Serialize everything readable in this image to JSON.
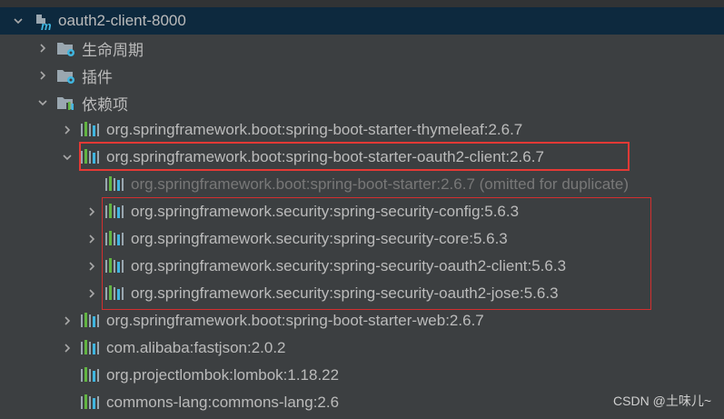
{
  "tree": {
    "root": {
      "label": "oauth2-client-8000",
      "icon": "maven-module-icon",
      "expanded": true,
      "selected": true
    },
    "lifecycle": {
      "label": "生命周期",
      "icon": "folder-gear-icon",
      "expanded": false
    },
    "plugins": {
      "label": "插件",
      "icon": "folder-gear-icon",
      "expanded": false
    },
    "dependencies": {
      "label": "依赖项",
      "icon": "folder-library-icon",
      "expanded": true
    },
    "deps": [
      {
        "label": "org.springframework.boot:spring-boot-starter-thymeleaf:2.6.7",
        "expandable": true,
        "expanded": false
      },
      {
        "label": "org.springframework.boot:spring-boot-starter-oauth2-client:2.6.7",
        "expandable": true,
        "expanded": true,
        "highlighted": true,
        "children": [
          {
            "label": "org.springframework.boot:spring-boot-starter:2.6.7 (omitted for duplicate)",
            "expandable": false,
            "omitted": true
          },
          {
            "label": "org.springframework.security:spring-security-config:5.6.3",
            "expandable": true
          },
          {
            "label": "org.springframework.security:spring-security-core:5.6.3",
            "expandable": true
          },
          {
            "label": "org.springframework.security:spring-security-oauth2-client:5.6.3",
            "expandable": true
          },
          {
            "label": "org.springframework.security:spring-security-oauth2-jose:5.6.3",
            "expandable": true
          }
        ]
      },
      {
        "label": "org.springframework.boot:spring-boot-starter-web:2.6.7",
        "expandable": true
      },
      {
        "label": "com.alibaba:fastjson:2.0.2",
        "expandable": true
      },
      {
        "label": "org.projectlombok:lombok:1.18.22",
        "expandable": false
      },
      {
        "label": "commons-lang:commons-lang:2.6",
        "expandable": false
      }
    ]
  },
  "watermark": "CSDN @土味儿~",
  "colors": {
    "highlight_box": "#e53935",
    "selection": "#0d293e",
    "library_green": "#62b543",
    "library_blue": "#40b6e0"
  }
}
